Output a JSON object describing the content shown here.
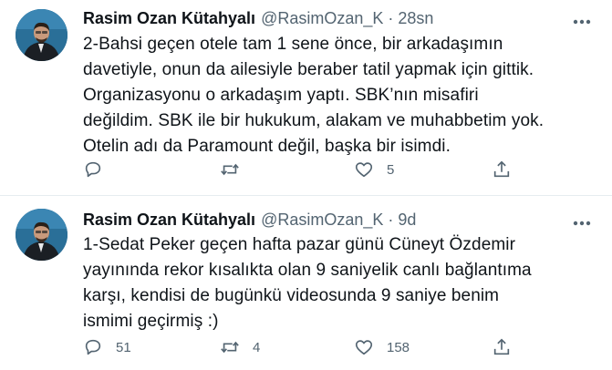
{
  "tweets": [
    {
      "author_name": "Rasim Ozan Kütahyalı",
      "handle": "@RasimOzan_K",
      "separator": "·",
      "time": "28sn",
      "text": "2-Bahsi geçen otele tam 1 sene önce, bir arkadaşımın\ndavetiyle, onun da ailesiyle beraber tatil yapmak için gittik.\nOrganizasyonu o arkadaşım yaptı. SBK’nın misafiri\ndeğildim. SBK ile bir hukukum, alakam ve muhabbetim yok.\nOtelin adı da Paramount değil, başka bir isimdi.",
      "reply_count": "",
      "retweet_count": "",
      "like_count": "5"
    },
    {
      "author_name": "Rasim Ozan Kütahyalı",
      "handle": "@RasimOzan_K",
      "separator": "·",
      "time": "9d",
      "text": "1-Sedat Peker geçen hafta pazar günü Cüneyt Özdemir\nyayınında rekor kısalıkta olan 9 saniyelik canlı bağlantıma\nkarşı, kendisi de bugünkü videosunda 9 saniye benim\nismimi geçirmiş :)",
      "reply_count": "51",
      "retweet_count": "4",
      "like_count": "158"
    }
  ],
  "icons": {
    "avatar": "avatar",
    "more": "more-horizontal-icon",
    "reply": "reply-icon",
    "retweet": "retweet-icon",
    "like": "heart-icon",
    "share": "share-icon"
  },
  "colors": {
    "text": "#0f1419",
    "secondary": "#536471",
    "divider": "#e6ecf0",
    "background": "#ffffff"
  }
}
